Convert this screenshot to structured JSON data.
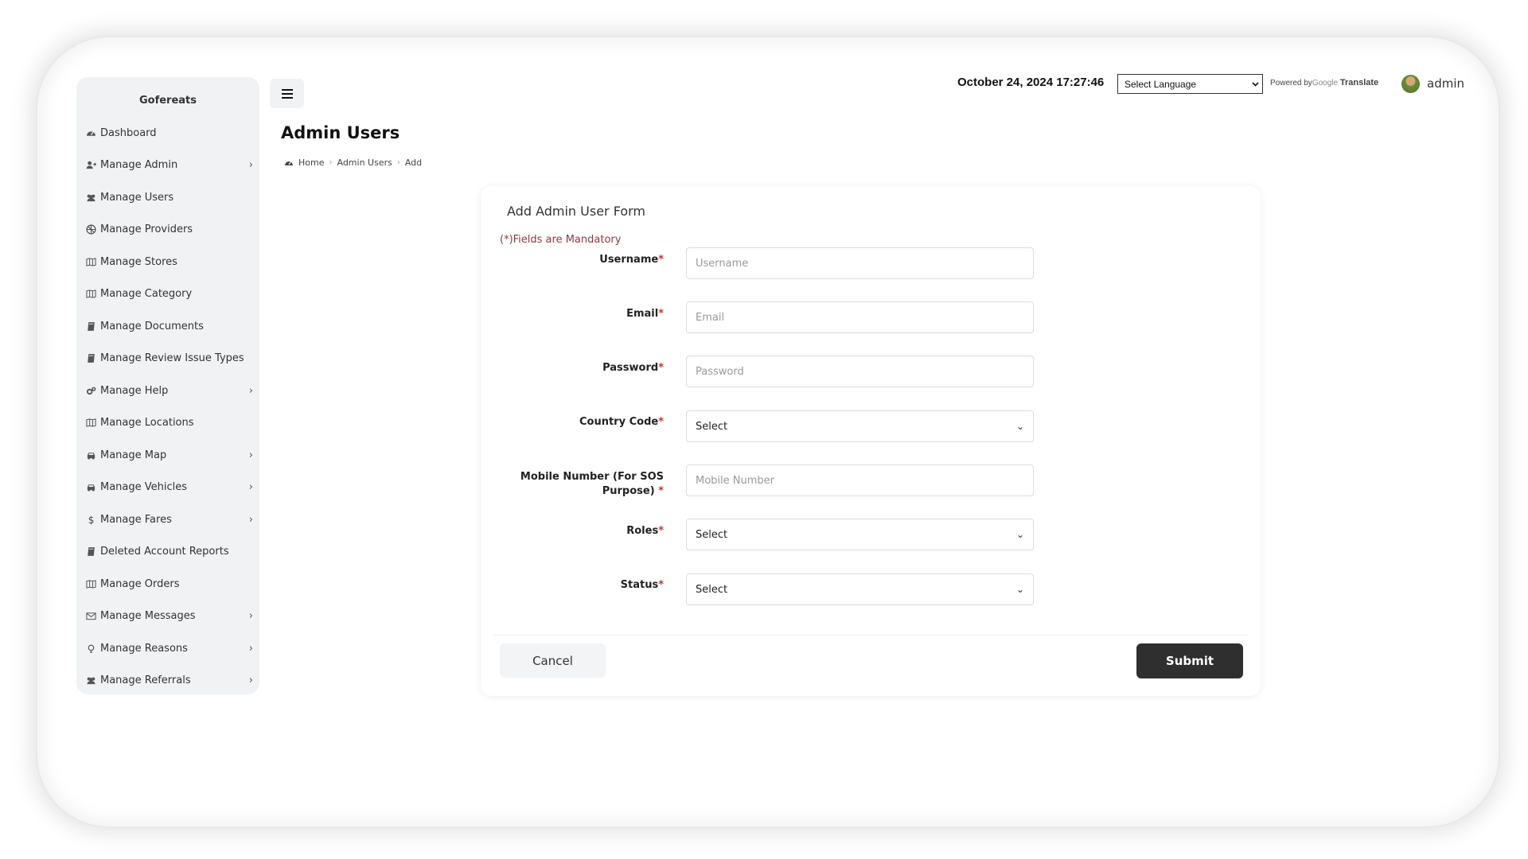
{
  "sidebar": {
    "brand": "Gofereats",
    "items": [
      {
        "label": "Dashboard",
        "icon": "dashboard-icon",
        "chevron": false
      },
      {
        "label": "Manage Admin",
        "icon": "user-plus-icon",
        "chevron": true
      },
      {
        "label": "Manage Users",
        "icon": "users-icon",
        "chevron": false
      },
      {
        "label": "Manage Providers",
        "icon": "providers-icon",
        "chevron": false
      },
      {
        "label": "Manage Stores",
        "icon": "map-icon",
        "chevron": false
      },
      {
        "label": "Manage Category",
        "icon": "map-icon",
        "chevron": false
      },
      {
        "label": "Manage Documents",
        "icon": "book-icon",
        "chevron": false
      },
      {
        "label": "Manage Review Issue Types",
        "icon": "book-icon",
        "chevron": false
      },
      {
        "label": "Manage Help",
        "icon": "cogs-icon",
        "chevron": true
      },
      {
        "label": "Manage Locations",
        "icon": "map-icon",
        "chevron": false
      },
      {
        "label": "Manage Map",
        "icon": "car-icon",
        "chevron": true
      },
      {
        "label": "Manage Vehicles",
        "icon": "car-icon",
        "chevron": true
      },
      {
        "label": "Manage Fares",
        "icon": "dollar-icon",
        "chevron": true
      },
      {
        "label": "Deleted Account Reports",
        "icon": "book-icon",
        "chevron": false
      },
      {
        "label": "Manage Orders",
        "icon": "map-icon",
        "chevron": false
      },
      {
        "label": "Manage Messages",
        "icon": "envelope-icon",
        "chevron": true
      },
      {
        "label": "Manage Reasons",
        "icon": "lightbulb-icon",
        "chevron": true
      },
      {
        "label": "Manage Referrals",
        "icon": "users-icon",
        "chevron": true
      }
    ]
  },
  "header": {
    "datetime": "October 24, 2024 17:27:46",
    "language_select": "Select Language",
    "powered_by": "Powered by",
    "google": "Google",
    "translate": "Translate",
    "user": "admin"
  },
  "page": {
    "title": "Admin Users",
    "breadcrumb": [
      "Home",
      "Admin Users",
      "Add"
    ]
  },
  "form": {
    "title": "Add Admin User Form",
    "mandatory_note": "(*)Fields are Mandatory",
    "fields": {
      "username": {
        "label": "Username",
        "placeholder": "Username"
      },
      "email": {
        "label": "Email",
        "placeholder": "Email"
      },
      "password": {
        "label": "Password",
        "placeholder": "Password"
      },
      "country_code": {
        "label": "Country Code",
        "value": "Select"
      },
      "mobile": {
        "label_line1": "Mobile Number (For SOS",
        "label_line2": "Purpose)",
        "placeholder": "Mobile Number"
      },
      "roles": {
        "label": "Roles",
        "value": "Select"
      },
      "status": {
        "label": "Status",
        "value": "Select"
      }
    },
    "required_mark": "*",
    "cancel": "Cancel",
    "submit": "Submit"
  }
}
